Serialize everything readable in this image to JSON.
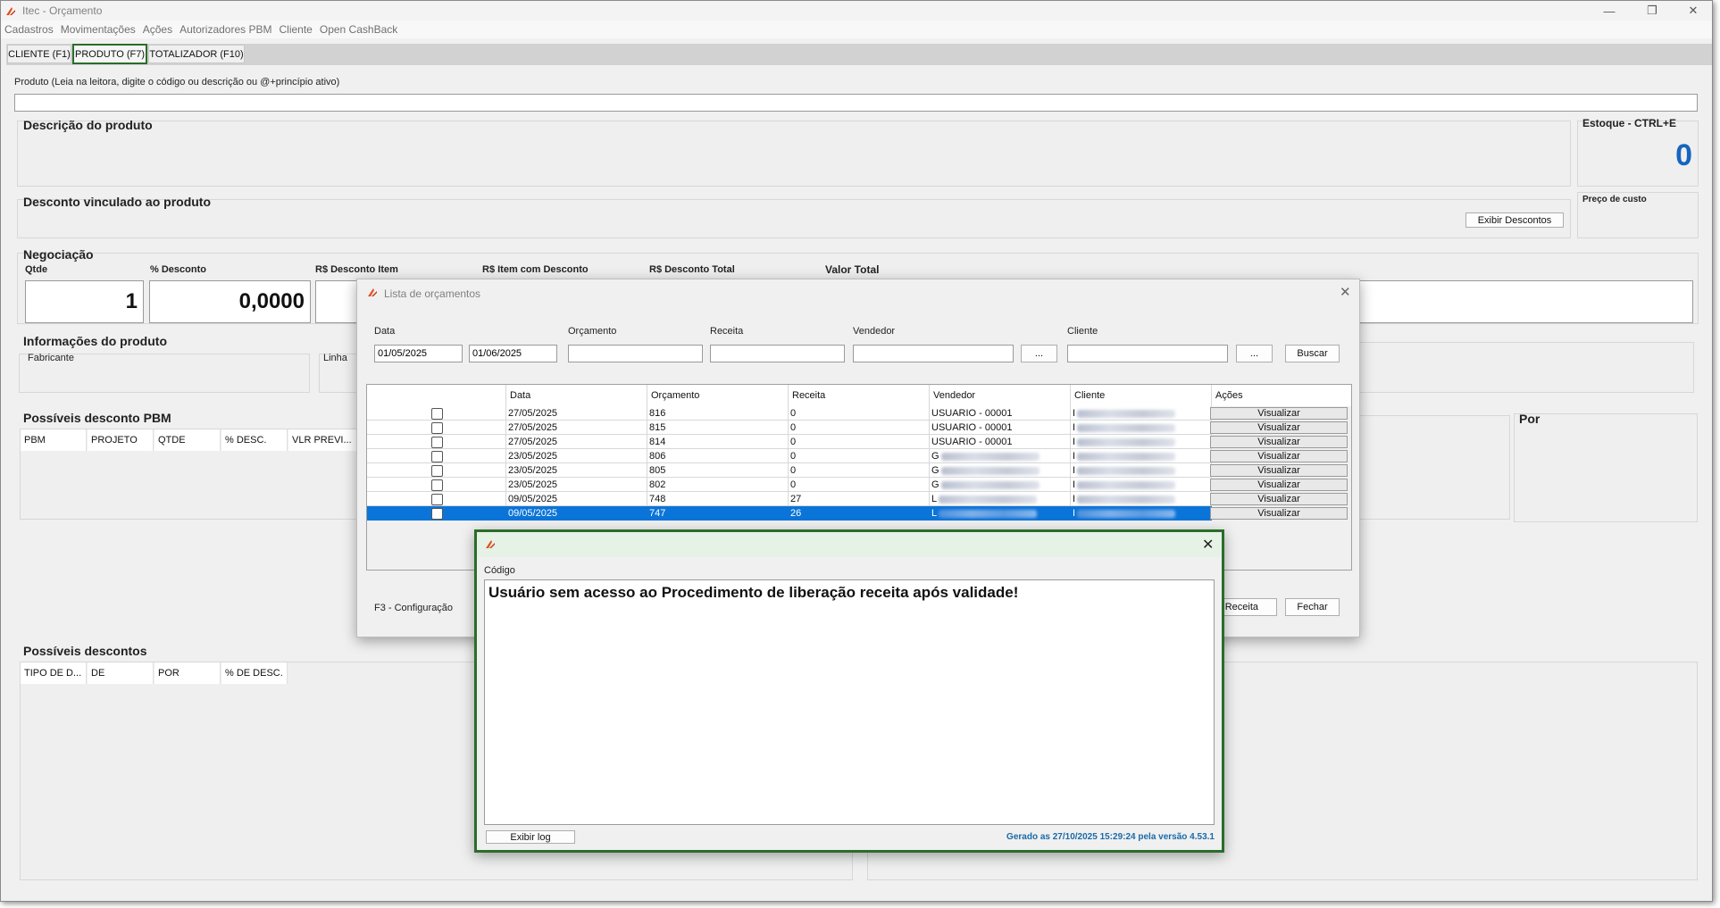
{
  "window": {
    "title": "Itec - Orçamento",
    "menu": [
      "Cadastros",
      "Movimentações",
      "Ações",
      "Autorizadores PBM",
      "Cliente",
      "Open CashBack"
    ],
    "tabs": [
      "CLIENTE (F1)",
      "PRODUTO (F7)",
      "TOTALIZADOR (F10)"
    ]
  },
  "produto": {
    "field_label": "Produto (Leia na leitora, digite o código ou descrição ou @+princípio ativo)",
    "descricao_title": "Descrição do produto",
    "estoque_title": "Estoque - CTRL+E",
    "estoque_value": "0",
    "desconto_vinculado_title": "Desconto vinculado ao produto",
    "exibir_descontos_btn": "Exibir Descontos",
    "preco_custo_label": "Preço de custo"
  },
  "negociacao": {
    "title": "Negociação",
    "qtde_label": "Qtde",
    "qtde_value": "1",
    "desconto_label": "% Desconto",
    "desconto_value": "0,0000",
    "desc_item_label": "R$ Desconto Item",
    "item_com_desc_label": "R$ Item com Desconto",
    "desc_total_label": "R$ Desconto Total",
    "valor_total_label": "Valor Total"
  },
  "info_produto": {
    "title": "Informações do produto",
    "fabricante_label": "Fabricante",
    "linha_label": "Linha"
  },
  "pbm": {
    "title": "Possíveis desconto PBM",
    "columns": [
      "PBM",
      "PROJETO",
      "QTDE",
      "% DESC.",
      "VLR PREVI..."
    ],
    "por_label": "Por"
  },
  "possiveis_descontos": {
    "title": "Possíveis descontos",
    "columns": [
      "TIPO DE D...",
      "DE",
      "POR",
      "% DE DESC."
    ]
  },
  "lista_orcamentos": {
    "title": "Lista de orçamentos",
    "data_label": "Data",
    "data_inicio": "01/05/2025",
    "data_fim": "01/06/2025",
    "orcamento_label": "Orçamento",
    "receita_label": "Receita",
    "vendedor_label": "Vendedor",
    "cliente_label": "Cliente",
    "ellipsis": "...",
    "buscar_btn": "Buscar",
    "columns": [
      "Data",
      "Orçamento",
      "Receita",
      "Vendedor",
      "Cliente",
      "Ações"
    ],
    "rows": [
      {
        "data": "27/05/2025",
        "orcamento": "816",
        "receita": "0",
        "vendedor": "USUARIO - 00001",
        "cliente": "I",
        "acao": "Visualizar"
      },
      {
        "data": "27/05/2025",
        "orcamento": "815",
        "receita": "0",
        "vendedor": "USUARIO - 00001",
        "cliente": "I",
        "acao": "Visualizar"
      },
      {
        "data": "27/05/2025",
        "orcamento": "814",
        "receita": "0",
        "vendedor": "USUARIO - 00001",
        "cliente": "I",
        "acao": "Visualizar"
      },
      {
        "data": "23/05/2025",
        "orcamento": "806",
        "receita": "0",
        "vendedor": "G",
        "cliente": "I",
        "acao": "Visualizar"
      },
      {
        "data": "23/05/2025",
        "orcamento": "805",
        "receita": "0",
        "vendedor": "G",
        "cliente": "I",
        "acao": "Visualizar"
      },
      {
        "data": "23/05/2025",
        "orcamento": "802",
        "receita": "0",
        "vendedor": "G",
        "cliente": "I",
        "acao": "Visualizar"
      },
      {
        "data": "09/05/2025",
        "orcamento": "748",
        "receita": "27",
        "vendedor": "L",
        "cliente": "I",
        "acao": "Visualizar"
      },
      {
        "data": "09/05/2025",
        "orcamento": "747",
        "receita": "26",
        "vendedor": "L",
        "cliente": "I",
        "acao": "Visualizar"
      }
    ],
    "selected_index": 7,
    "config_hint": "F3 - Configuração",
    "receita_btn": "r Receita",
    "fechar_btn": "Fechar"
  },
  "erro": {
    "codigo_label": "Código",
    "message": "Usuário sem acesso ao Procedimento de liberação receita após validade!",
    "exibir_log_btn": "Exibir log",
    "footer": "Gerado as 27/10/2025 15:29:24 pela versão 4.53.1"
  },
  "colors": {
    "accent_green": "#2a6d2a",
    "selection_blue": "#0b74d8",
    "stock_blue": "#1565c0",
    "footer_blue": "#1a6aa8"
  }
}
